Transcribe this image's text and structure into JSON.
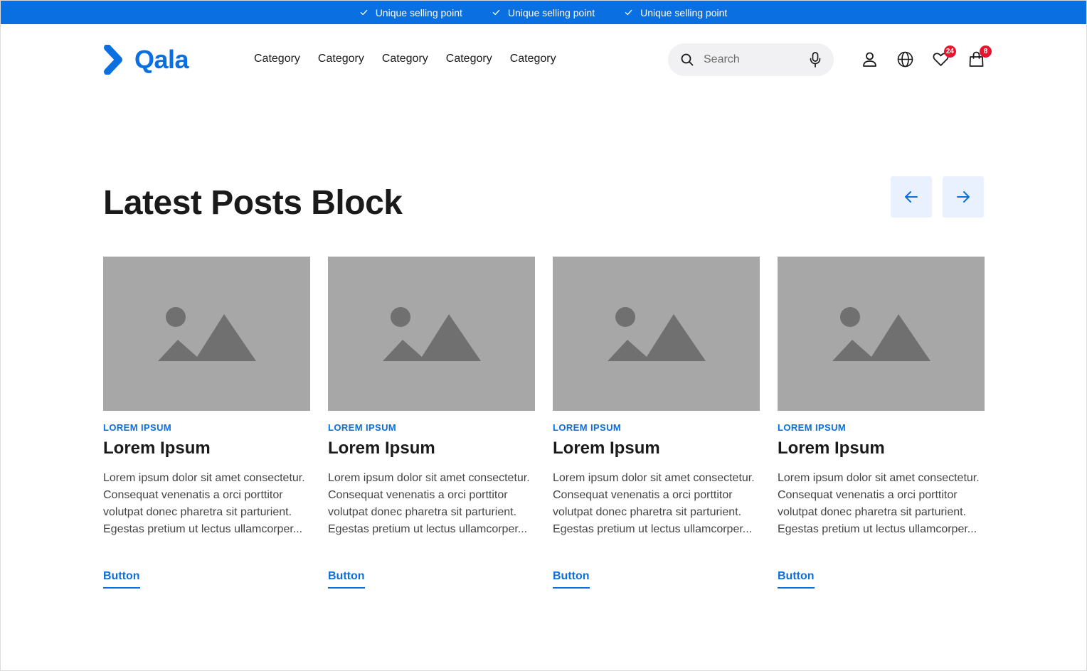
{
  "colors": {
    "brand": "#0a6fe0",
    "badge": "#e3172d",
    "image_placeholder": "#a7a7a7",
    "arrow_button_bg": "#e8f1fd"
  },
  "usp_bar": {
    "items": [
      {
        "icon": "check-icon",
        "label": "Unique selling point"
      },
      {
        "icon": "check-icon",
        "label": "Unique selling point"
      },
      {
        "icon": "check-icon",
        "label": "Unique selling point"
      }
    ]
  },
  "header": {
    "logo_text": "Qala",
    "nav": [
      "Category",
      "Category",
      "Category",
      "Category",
      "Category"
    ],
    "search": {
      "placeholder": "Search",
      "value": ""
    },
    "icons": {
      "account": "user-icon",
      "language": "globe-icon",
      "wishlist": {
        "icon": "heart-icon",
        "count": "24"
      },
      "cart": {
        "icon": "bag-icon",
        "count": "8"
      }
    }
  },
  "section": {
    "title": "Latest Posts Block",
    "prev_icon": "arrow-left-icon",
    "next_icon": "arrow-right-icon"
  },
  "posts": [
    {
      "category": "LOREM IPSUM",
      "title": "Lorem Ipsum",
      "excerpt": "Lorem ipsum dolor sit amet consectetur. Consequat venenatis a orci porttitor volutpat donec pharetra sit parturient. Egestas pretium ut lectus ullamcorper...",
      "button": "Button"
    },
    {
      "category": "LOREM IPSUM",
      "title": "Lorem Ipsum",
      "excerpt": "Lorem ipsum dolor sit amet consectetur. Consequat venenatis a orci porttitor volutpat donec pharetra sit parturient. Egestas pretium ut lectus ullamcorper...",
      "button": "Button"
    },
    {
      "category": "LOREM IPSUM",
      "title": "Lorem Ipsum",
      "excerpt": "Lorem ipsum dolor sit amet consectetur. Consequat venenatis a orci porttitor volutpat donec pharetra sit parturient. Egestas pretium ut lectus ullamcorper...",
      "button": "Button"
    },
    {
      "category": "LOREM IPSUM",
      "title": "Lorem Ipsum",
      "excerpt": "Lorem ipsum dolor sit amet consectetur. Consequat venenatis a orci porttitor volutpat donec pharetra sit parturient. Egestas pretium ut lectus ullamcorper...",
      "button": "Button"
    }
  ]
}
